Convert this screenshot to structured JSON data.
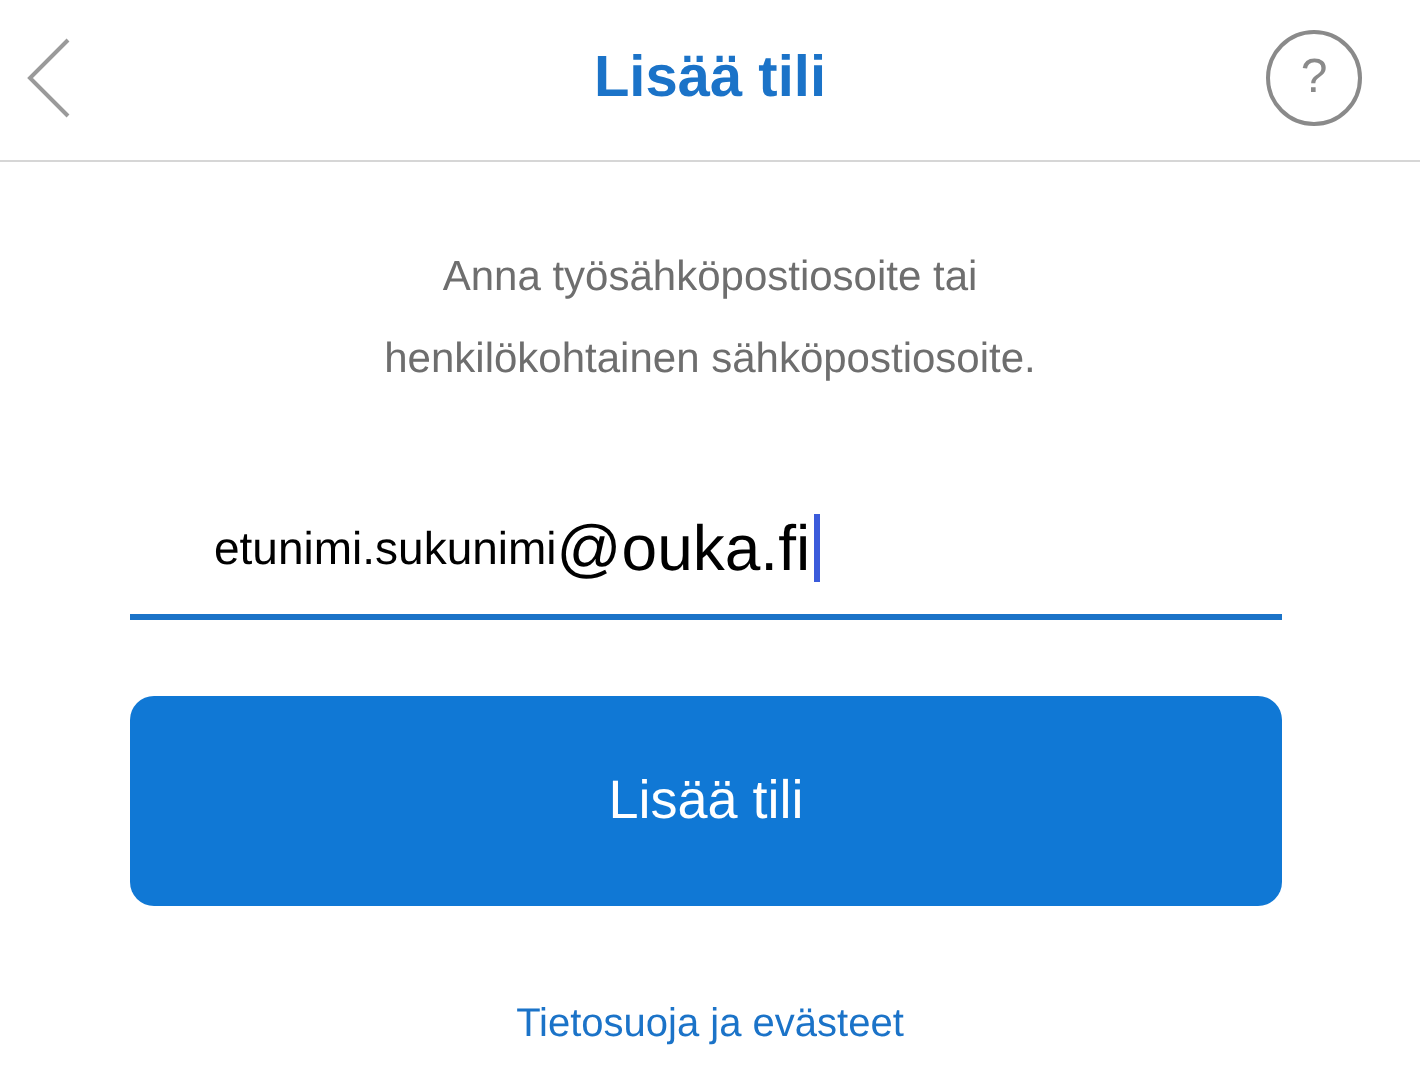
{
  "header": {
    "title": "Lisää tili",
    "help": "?"
  },
  "instruction": "Anna työsähköpostiosoite tai henkilökohtainen sähköpostiosoite.",
  "email_field": {
    "local_part": "etunimi.sukunimi",
    "domain": "@ouka.fi",
    "focused": true
  },
  "add_button": "Lisää tili",
  "privacy_link": "Tietosuoja ja evästeet"
}
